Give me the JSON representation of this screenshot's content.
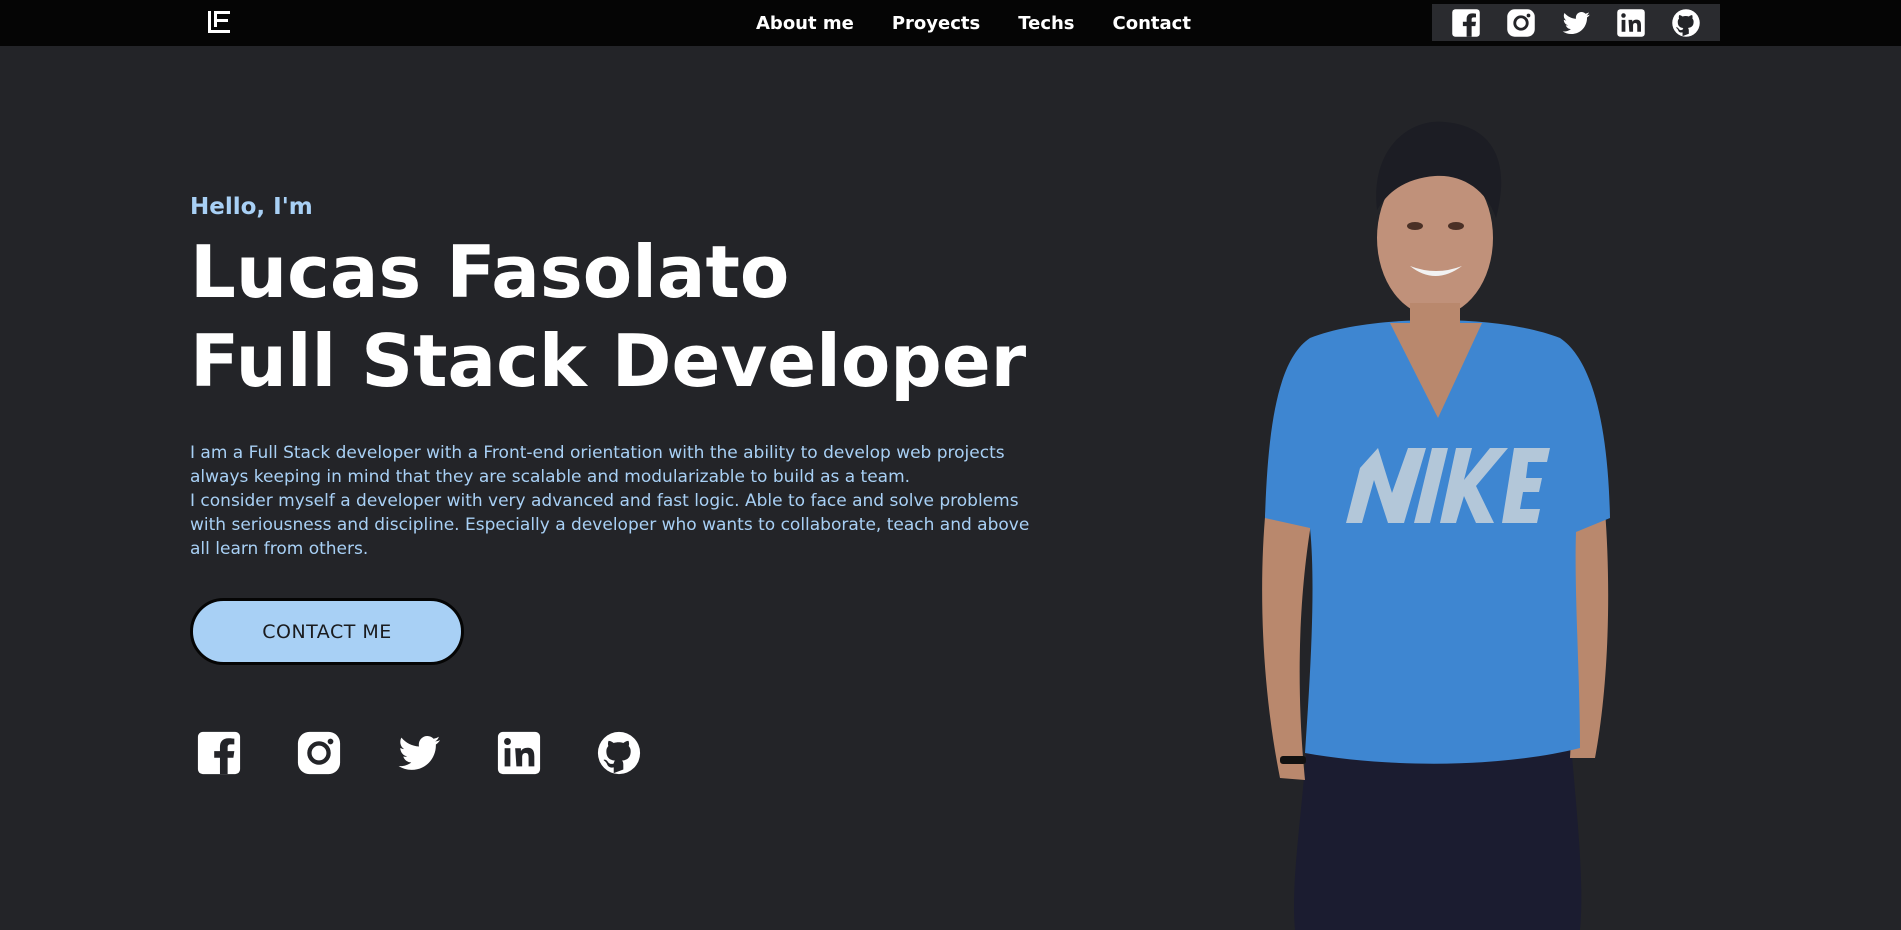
{
  "nav": {
    "logo_icon": "lf-logo-icon",
    "links": [
      "About me",
      "Proyects",
      "Techs",
      "Contact"
    ],
    "social": [
      "facebook-icon",
      "instagram-icon",
      "twitter-icon",
      "linkedin-icon",
      "github-icon"
    ]
  },
  "hero": {
    "greeting": "Hello, I'm",
    "name": "Lucas Fasolato",
    "role": "Full Stack Developer",
    "bio_line_1": "I am a Full Stack developer with a Front-end orientation with the ability to develop web projects always keeping in mind that they are scalable and modularizable to build as a team.",
    "bio_line_2": "I consider myself a developer with very advanced and fast logic. Able to face and solve problems with seriousness and discipline. Especially a developer who wants to collaborate, teach and above all learn from others.",
    "cta_label": "CONTACT ME",
    "social": [
      "facebook-icon",
      "instagram-icon",
      "twitter-icon",
      "linkedin-icon",
      "github-icon"
    ]
  },
  "colors": {
    "background": "#232428",
    "navbar": "#050505",
    "accent": "#a8d0f5",
    "text": "#ffffff"
  }
}
